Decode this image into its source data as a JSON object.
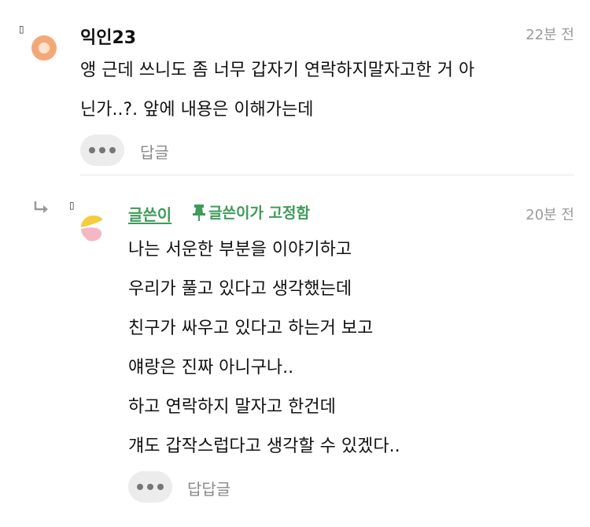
{
  "comment": {
    "marker": "▯",
    "author": "익인23",
    "time": "22분 전",
    "lines": [
      "앵 근데 쓰니도 좀 너무 갑자기 연락하지말자고한 거 아",
      "닌가..?. 앞에 내용은 이해가는데"
    ],
    "reply_label": "답글",
    "avatar_color": "#f2a877"
  },
  "reply": {
    "marker": "▯",
    "author": "글쓴이",
    "pinned_label": "글쓴이가 고정함",
    "time": "20분 전",
    "lines": [
      "나는 서운한 부분을 이야기하고",
      "우리가 풀고 있다고 생각했는데",
      "친구가 싸우고 있다고 하는거 보고",
      "얘랑은 진짜 아니구나..",
      "하고 연락하지 말자고 한건데",
      "걔도 갑작스럽다고 생각할 수 있겠다.."
    ],
    "reply_label": "답답글",
    "accent_color": "#3f9b5a"
  },
  "icons": {
    "avatar_1": "peach-circle-avatar-icon",
    "avatar_2": "yellow-pink-avatar-icon",
    "pin": "pin-icon",
    "reply_arrow": "reply-arrow-icon",
    "more": "more-dots-icon"
  }
}
